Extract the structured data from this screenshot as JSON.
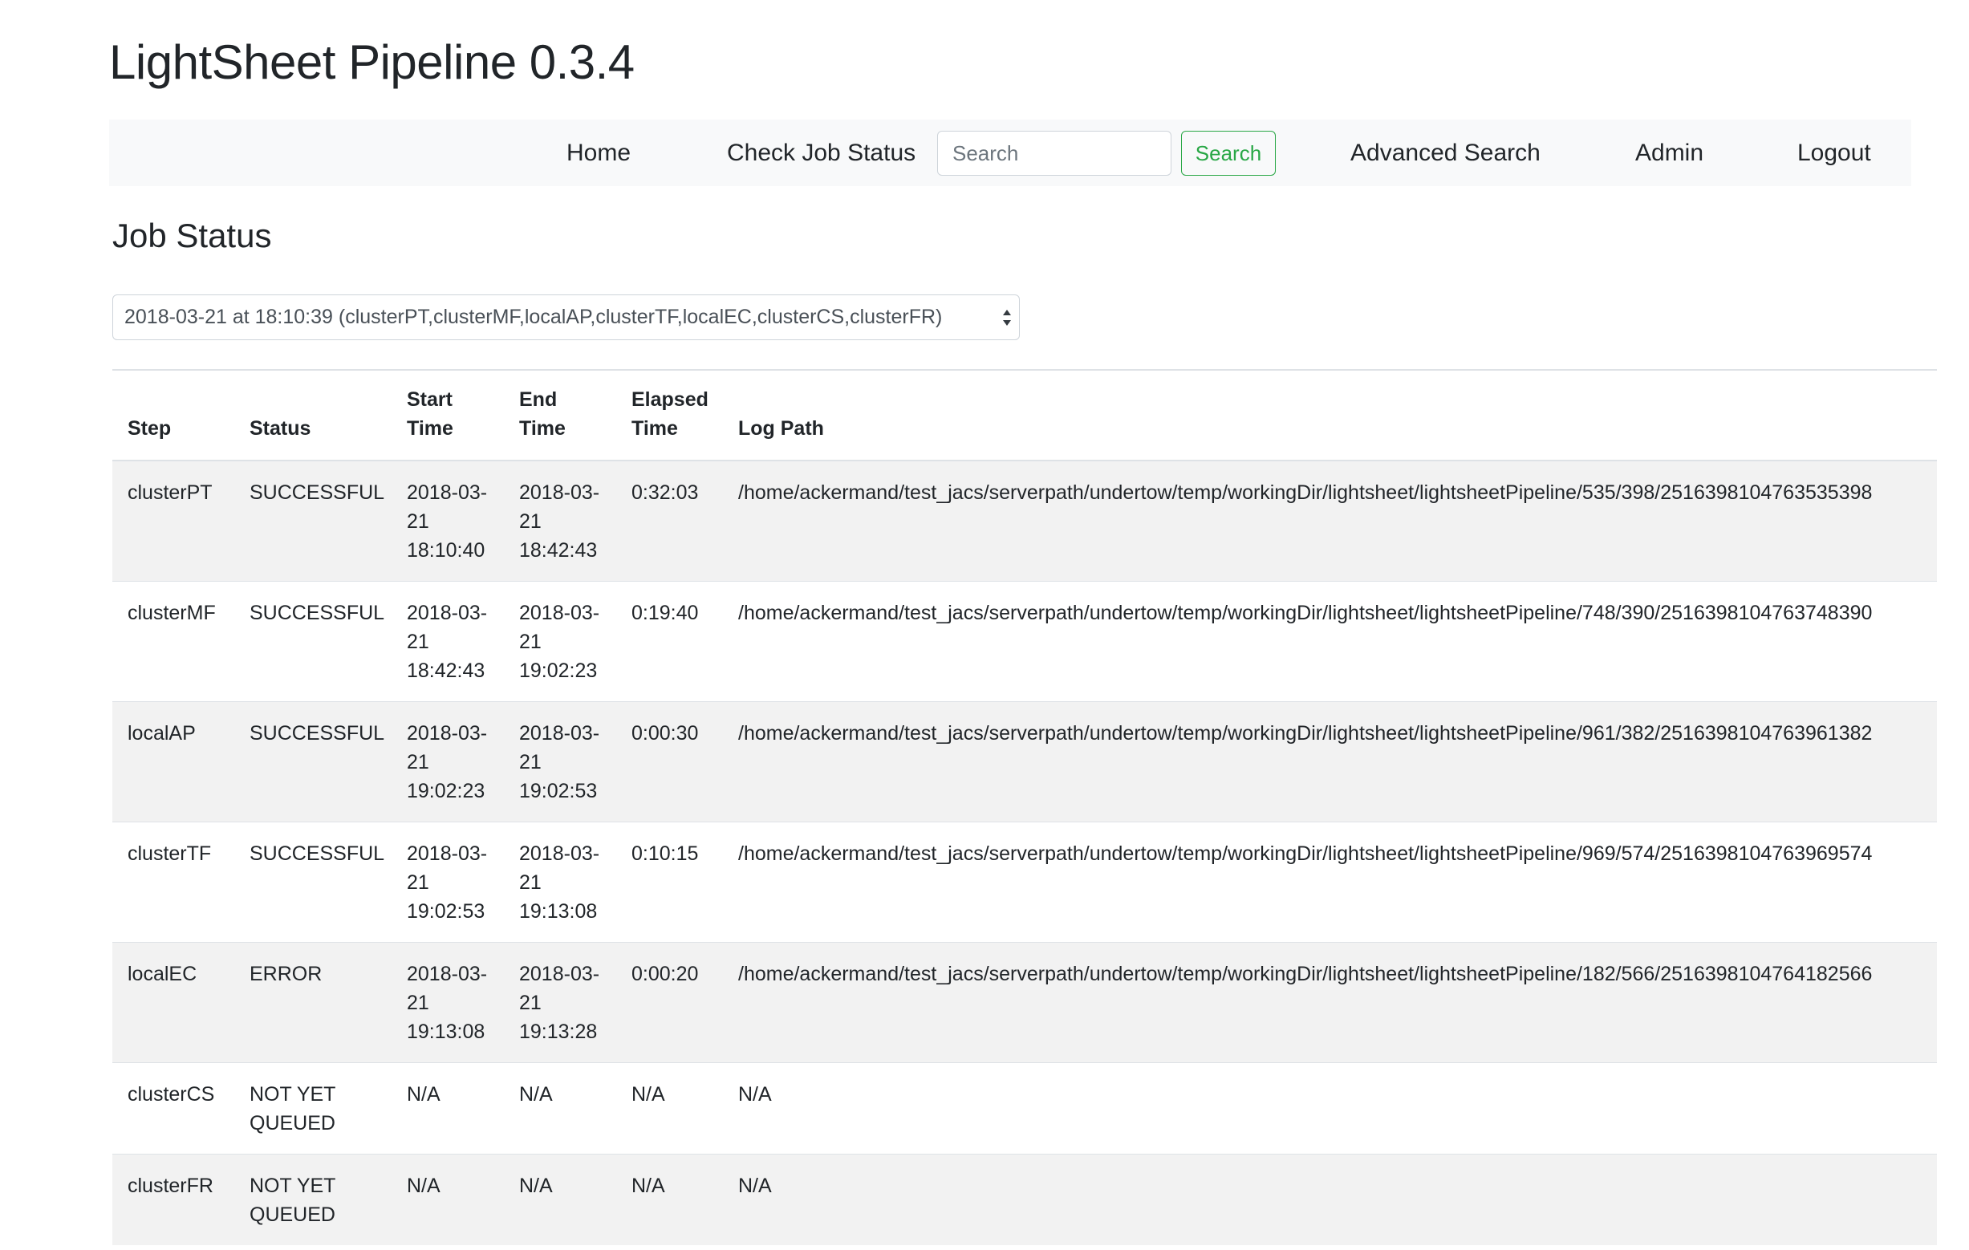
{
  "app": {
    "title": "LightSheet Pipeline 0.3.4"
  },
  "nav": {
    "home": "Home",
    "check_job_status": "Check Job Status",
    "search_placeholder": "Search",
    "search_button": "Search",
    "advanced_search": "Advanced Search",
    "admin": "Admin",
    "logout": "Logout"
  },
  "page": {
    "title": "Job Status"
  },
  "job_select": {
    "value": "2018-03-21 at 18:10:39 (clusterPT,clusterMF,localAP,clusterTF,localEC,clusterCS,clusterFR)"
  },
  "table": {
    "headers": [
      "Step",
      "Status",
      "Start Time",
      "End Time",
      "Elapsed Time",
      "Log Path"
    ],
    "rows": [
      {
        "step": "clusterPT",
        "status": "SUCCESSFUL",
        "start": "2018-03-21 18:10:40",
        "end": "2018-03-21 18:42:43",
        "elapsed": "0:32:03",
        "log": "/home/ackermand/test_jacs/serverpath/undertow/temp/workingDir/lightsheet/lightsheetPipeline/535/398/2516398104763535398"
      },
      {
        "step": "clusterMF",
        "status": "SUCCESSFUL",
        "start": "2018-03-21 18:42:43",
        "end": "2018-03-21 19:02:23",
        "elapsed": "0:19:40",
        "log": "/home/ackermand/test_jacs/serverpath/undertow/temp/workingDir/lightsheet/lightsheetPipeline/748/390/2516398104763748390"
      },
      {
        "step": "localAP",
        "status": "SUCCESSFUL",
        "start": "2018-03-21 19:02:23",
        "end": "2018-03-21 19:02:53",
        "elapsed": "0:00:30",
        "log": "/home/ackermand/test_jacs/serverpath/undertow/temp/workingDir/lightsheet/lightsheetPipeline/961/382/2516398104763961382"
      },
      {
        "step": "clusterTF",
        "status": "SUCCESSFUL",
        "start": "2018-03-21 19:02:53",
        "end": "2018-03-21 19:13:08",
        "elapsed": "0:10:15",
        "log": "/home/ackermand/test_jacs/serverpath/undertow/temp/workingDir/lightsheet/lightsheetPipeline/969/574/2516398104763969574"
      },
      {
        "step": "localEC",
        "status": "ERROR",
        "start": "2018-03-21 19:13:08",
        "end": "2018-03-21 19:13:28",
        "elapsed": "0:00:20",
        "log": "/home/ackermand/test_jacs/serverpath/undertow/temp/workingDir/lightsheet/lightsheetPipeline/182/566/2516398104764182566"
      },
      {
        "step": "clusterCS",
        "status": "NOT YET QUEUED",
        "start": "N/A",
        "end": "N/A",
        "elapsed": "N/A",
        "log": "N/A"
      },
      {
        "step": "clusterFR",
        "status": "NOT YET QUEUED",
        "start": "N/A",
        "end": "N/A",
        "elapsed": "N/A",
        "log": "N/A"
      }
    ]
  },
  "colors": {
    "navbar_bg": "#f8f9fa",
    "success_green": "#28a745",
    "stripe_gray": "#f2f2f2",
    "text": "#212529"
  }
}
